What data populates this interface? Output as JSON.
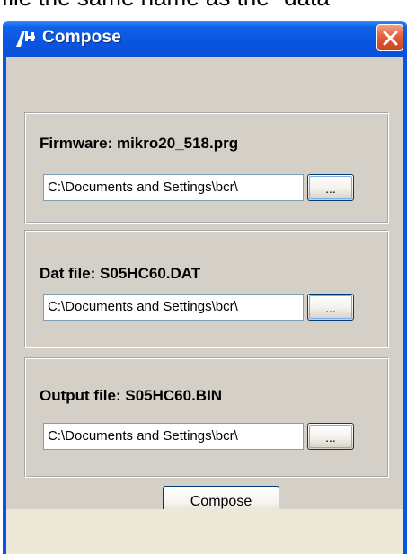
{
  "background": {
    "caption": "file the same name as the \"data"
  },
  "window": {
    "title": "Compose",
    "icon": "app-logo-icon",
    "close_icon": "close-icon"
  },
  "groups": [
    {
      "label": "Firmware: mikro20_518.prg",
      "path": "C:\\Documents and Settings\\bcr\\",
      "browse_label": "..."
    },
    {
      "label": "Dat file: S05HC60.DAT",
      "path": "C:\\Documents and Settings\\bcr\\",
      "browse_label": "..."
    },
    {
      "label": "Output file: S05HC60.BIN",
      "path": "C:\\Documents and Settings\\bcr\\",
      "browse_label": "..."
    }
  ],
  "compose_button": {
    "label": "Compose"
  },
  "colors": {
    "titlebar": "#0a55e6",
    "client": "#d4d0c8",
    "close": "#e0603a"
  }
}
